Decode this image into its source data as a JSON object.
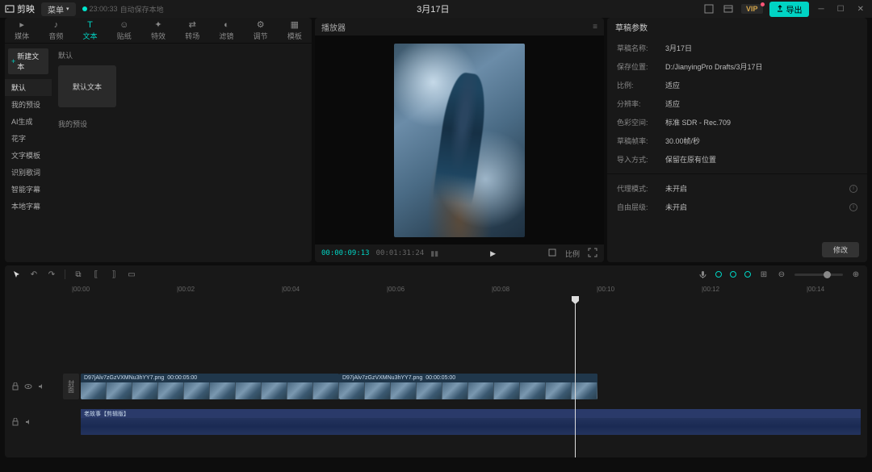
{
  "titlebar": {
    "app": "剪映",
    "menu": "菜单",
    "autosave_time": "23:00:33",
    "autosave_text": "自动保存本地",
    "project": "3月17日",
    "vip": "VIP",
    "export": "导出"
  },
  "library": {
    "tabs": [
      "媒体",
      "音频",
      "文本",
      "贴纸",
      "特效",
      "转场",
      "滤镜",
      "调节",
      "模板"
    ],
    "active_tab": 2,
    "new_text": "新建文本",
    "sidebar": [
      "默认",
      "我的预设",
      "AI生成",
      "花字",
      "文字模板",
      "识别歌词",
      "智能字幕",
      "本地字幕"
    ],
    "active_side": 0,
    "section1": "默认",
    "thumb_text": "默认文本",
    "section2": "我的预设"
  },
  "preview": {
    "title": "播放器",
    "tc_current": "00:00:09:13",
    "tc_total": "00:01:31:24",
    "ratio": "比例"
  },
  "props": {
    "title": "草稿参数",
    "rows": [
      {
        "label": "草稿名称:",
        "val": "3月17日"
      },
      {
        "label": "保存位置:",
        "val": "D:/JianyingPro Drafts/3月17日"
      },
      {
        "label": "比例:",
        "val": "适应"
      },
      {
        "label": "分辨率:",
        "val": "适应"
      },
      {
        "label": "色彩空间:",
        "val": "标准 SDR - Rec.709"
      },
      {
        "label": "草稿帧率:",
        "val": "30.00帧/秒"
      },
      {
        "label": "导入方式:",
        "val": "保留在原有位置"
      }
    ],
    "rows2": [
      {
        "label": "代理模式:",
        "val": "未开启"
      },
      {
        "label": "自由层级:",
        "val": "未开启"
      }
    ],
    "modify": "修改"
  },
  "timeline": {
    "ticks": [
      "|00:00",
      "|00:02",
      "|00:04",
      "|00:06",
      "|00:08",
      "|00:10",
      "|00:12",
      "|00:14"
    ],
    "cover": "封面",
    "clip1_name": "D97jAlv7zGzVXMNu3hYY7.png",
    "clip1_dur": "00:00:05:00",
    "clip2_name": "D97jAlv7zGzVXMNu3hYY7.png",
    "clip2_dur": "00:00:05:00",
    "audio_name": "老故事【剪辑版】"
  }
}
